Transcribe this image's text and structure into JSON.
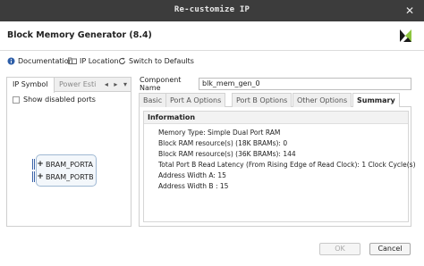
{
  "window": {
    "title": "Re-customize IP",
    "close_symbol": "✕"
  },
  "header": {
    "app_title": "Block Memory Generator (8.4)",
    "logo_icon": "vivado-logo-icon"
  },
  "toolbar": {
    "documentation": "Documentation",
    "ip_location": "IP Location",
    "switch_defaults": "Switch to Defaults"
  },
  "left_panel": {
    "tabs": [
      "IP Symbol",
      "Power Esti"
    ],
    "tab_arrows": "◂ ▸ ▾",
    "show_disabled_ports": "Show disabled ports",
    "show_disabled_checked": false,
    "ports": [
      "BRAM_PORTA",
      "BRAM_PORTB"
    ]
  },
  "component": {
    "label": "Component Name",
    "value": "blk_mem_gen_0"
  },
  "right_panel": {
    "tabs": [
      "Basic",
      "Port A Options",
      "Port B Options",
      "Other Options",
      "Summary"
    ],
    "active_tab": "Summary",
    "info_heading": "Information",
    "info_lines": [
      "Memory Type: Simple Dual Port RAM",
      "Block RAM resource(s) (18K BRAMs): 0",
      "Block RAM resource(s) (36K BRAMs): 144",
      "Total Port B Read Latency (From Rising Edge of Read Clock): 1 Clock Cycle(s)",
      "Address Width A: 15",
      "Address Width B : 15"
    ]
  },
  "buttons": {
    "ok": "OK",
    "cancel": "Cancel"
  },
  "colors": {
    "titlebar": "#3c3c3c",
    "logo_green": "#8dc63f",
    "port_blue": "#3b63a8"
  }
}
